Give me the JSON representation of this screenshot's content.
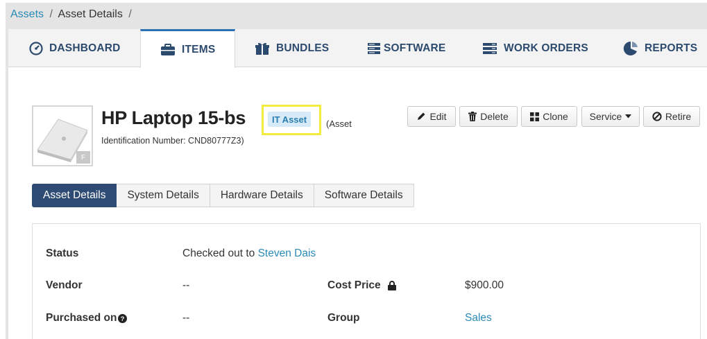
{
  "breadcrumb": {
    "root": "Assets",
    "separator": "/",
    "current": "Asset Details"
  },
  "nav": {
    "tabs": [
      {
        "label": "DASHBOARD",
        "icon": "dashboard-gauge-icon"
      },
      {
        "label": "ITEMS",
        "icon": "briefcase-icon",
        "active": true
      },
      {
        "label": "BUNDLES",
        "icon": "gift-icon"
      },
      {
        "label": "SOFTWARE",
        "icon": "server-icon"
      },
      {
        "label": "WORK ORDERS",
        "icon": "work-orders-icon"
      },
      {
        "label": "REPORTS",
        "icon": "pie-chart-icon"
      }
    ]
  },
  "asset": {
    "title": "HP Laptop 15-bs",
    "badge": "IT Asset",
    "paren_text": "(Asset",
    "identification": "Identification Number: CND80777Z3)",
    "thumb_badge": "F"
  },
  "actions": {
    "edit": "Edit",
    "delete": "Delete",
    "clone": "Clone",
    "service": "Service",
    "retire": "Retire"
  },
  "subtabs": [
    {
      "label": "Asset Details",
      "active": true
    },
    {
      "label": "System Details"
    },
    {
      "label": "Hardware Details"
    },
    {
      "label": "Software Details"
    }
  ],
  "details": {
    "status_label": "Status",
    "status_prefix": "Checked out to ",
    "status_user": "Steven Dais",
    "vendor_label": "Vendor",
    "vendor_value": "--",
    "cost_label": "Cost Price",
    "cost_value": "$900.00",
    "purchased_label": "Purchased on",
    "purchased_value": "--",
    "group_label": "Group",
    "group_value": "Sales"
  },
  "colors": {
    "accent": "#2c6fb3",
    "link": "#2a8ab5",
    "active_subtab": "#2e4b74",
    "highlight": "#f3ec3c",
    "badge_bg": "#d6eaf7"
  }
}
